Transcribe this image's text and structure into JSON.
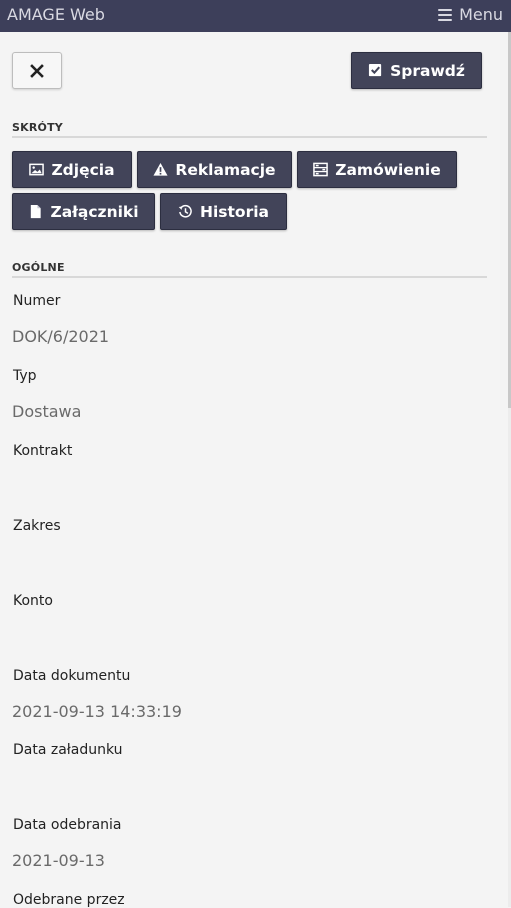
{
  "navbar": {
    "brand": "AMAGE Web",
    "menu_label": "Menu"
  },
  "toolbar": {
    "check_label": "Sprawdź"
  },
  "sections": {
    "shortcuts_title": "SKRÓTY",
    "general_title": "OGÓLNE"
  },
  "shortcuts": [
    {
      "label": "Zdjęcia",
      "icon": "image-icon"
    },
    {
      "label": "Reklamacje",
      "icon": "warning-icon"
    },
    {
      "label": "Zamówienie",
      "icon": "order-icon"
    },
    {
      "label": "Załączniki",
      "icon": "file-icon"
    },
    {
      "label": "Historia",
      "icon": "history-icon"
    }
  ],
  "fields": [
    {
      "label": "Numer",
      "value": "DOK/6/2021"
    },
    {
      "label": "Typ",
      "value": "Dostawa"
    },
    {
      "label": "Kontrakt",
      "value": ""
    },
    {
      "label": "Zakres",
      "value": ""
    },
    {
      "label": "Konto",
      "value": ""
    },
    {
      "label": "Data dokumentu",
      "value": "2021-09-13 14:33:19"
    },
    {
      "label": "Data załadunku",
      "value": ""
    },
    {
      "label": "Data odebrania",
      "value": "2021-09-13"
    },
    {
      "label": "Odebrane przez",
      "value": ""
    }
  ]
}
